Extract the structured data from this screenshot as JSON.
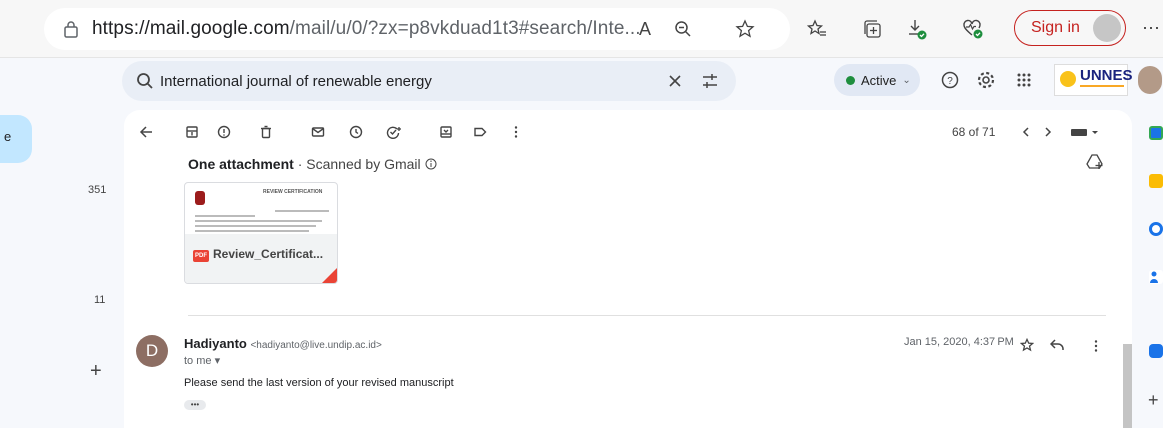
{
  "browser": {
    "url_host": "https://mail.google.com",
    "url_path": "/mail/u/0/?zx=p8vkduad1t3#search/Inte...",
    "read_aloud_glyph": "A",
    "signin_label": "Sign in",
    "more_glyph": "⋯"
  },
  "search": {
    "query": "International journal of renewable energy"
  },
  "status": {
    "label": "Active"
  },
  "logo_text": "UNNES",
  "left_counts": [
    "351",
    "11"
  ],
  "compose_stub": "e",
  "toolbar": {
    "pager": "68 of 71"
  },
  "attachment": {
    "heading": "One attachment",
    "scanned": "·  Scanned by Gmail",
    "file_name": "Review_Certificat...",
    "badge": "PDF",
    "preview_title": "REVIEW CERTIFICATION"
  },
  "message": {
    "avatar_letter": "D",
    "sender_name": "Hadiyanto",
    "sender_email": "<hadiyanto@live.undip.ac.id>",
    "to": "to me ▾",
    "date": "Jan 15, 2020, 4:37 PM",
    "body": "Please send the last version of your revised manuscript",
    "more": "•••"
  },
  "colors": {
    "accent_red": "#c5221f",
    "active_green": "#1e8e3e",
    "pdf_red": "#ea4335"
  }
}
